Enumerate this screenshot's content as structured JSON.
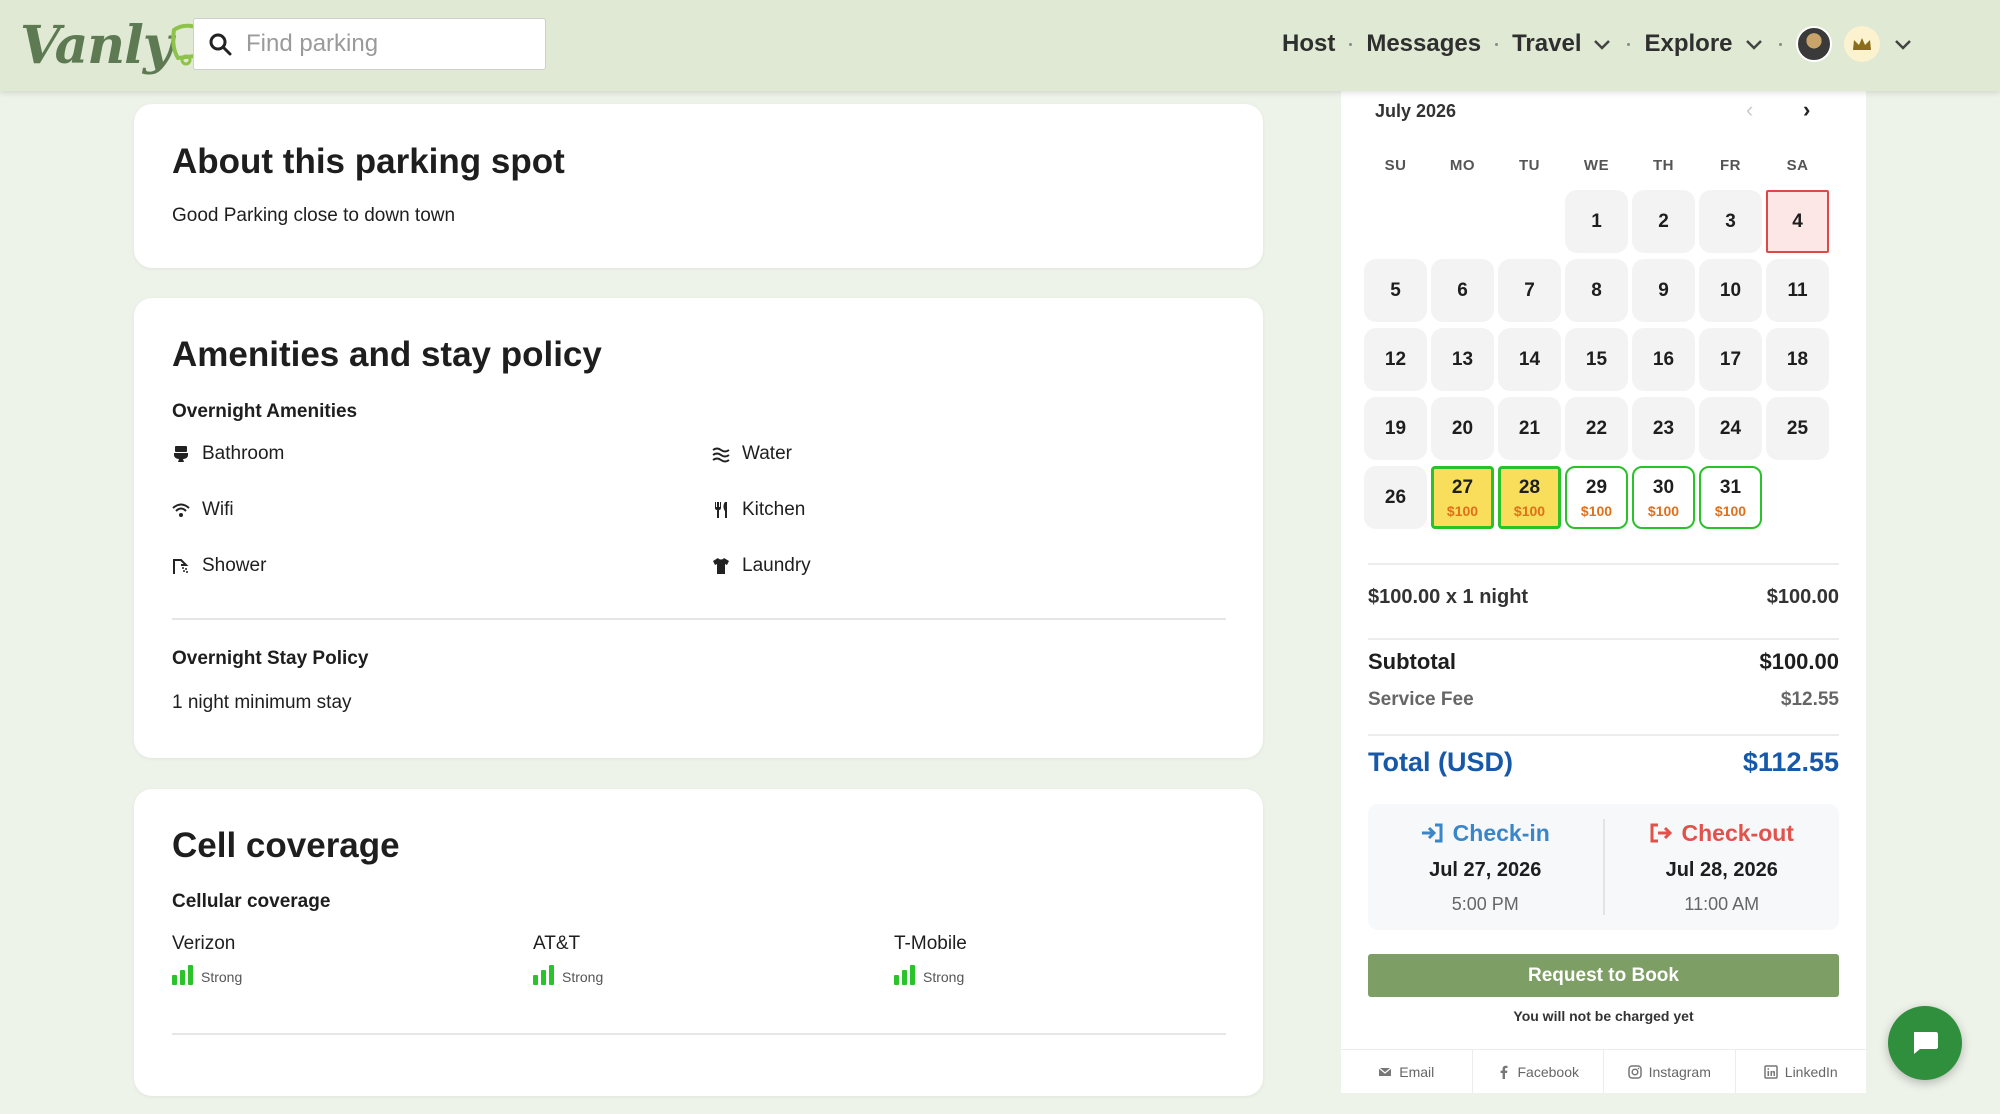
{
  "brand": {
    "logo_text": "Vanly"
  },
  "search": {
    "placeholder": "Find parking"
  },
  "nav": {
    "host": "Host",
    "messages": "Messages",
    "travel": "Travel",
    "explore": "Explore"
  },
  "about": {
    "title": "About this parking spot",
    "description": "Good Parking close to down town"
  },
  "amenities": {
    "title": "Amenities and stay policy",
    "overnight_label": "Overnight Amenities",
    "items": [
      {
        "label": "Bathroom",
        "icon": "toilet-icon"
      },
      {
        "label": "Water",
        "icon": "water-icon"
      },
      {
        "label": "Wifi",
        "icon": "wifi-icon"
      },
      {
        "label": "Kitchen",
        "icon": "utensils-icon"
      },
      {
        "label": "Shower",
        "icon": "shower-icon"
      },
      {
        "label": "Laundry",
        "icon": "shirt-icon"
      }
    ],
    "policy_label": "Overnight Stay Policy",
    "policy_text": "1 night minimum stay"
  },
  "cell": {
    "title": "Cell coverage",
    "subtitle": "Cellular coverage",
    "carriers": [
      {
        "name": "Verizon",
        "strength": "Strong"
      },
      {
        "name": "AT&T",
        "strength": "Strong"
      },
      {
        "name": "T-Mobile",
        "strength": "Strong"
      }
    ]
  },
  "calendar": {
    "month": "July 2026",
    "weekdays": [
      "SU",
      "MO",
      "TU",
      "WE",
      "TH",
      "FR",
      "SA"
    ],
    "today": "4",
    "selected": [
      "27",
      "28"
    ],
    "available": [
      "27",
      "28",
      "29",
      "30",
      "31"
    ],
    "price": "$100"
  },
  "pricing": {
    "nightly_label": "$100.00 x 1 night",
    "nightly_value": "$100.00",
    "subtotal_label": "Subtotal",
    "subtotal_value": "$100.00",
    "fee_label": "Service Fee",
    "fee_value": "$12.55",
    "total_label": "Total (USD)",
    "total_value": "$112.55"
  },
  "checkin": {
    "label": "Check-in",
    "date": "Jul 27, 2026",
    "time": "5:00 PM",
    "color": "#3a86c8"
  },
  "checkout": {
    "label": "Check-out",
    "date": "Jul 28, 2026",
    "time": "11:00 AM",
    "color": "#e0524b"
  },
  "booking": {
    "button": "Request to Book",
    "note": "You will not be charged yet"
  },
  "share": {
    "email": "Email",
    "facebook": "Facebook",
    "instagram": "Instagram",
    "linkedin": "LinkedIn"
  },
  "colors": {
    "accent": "#7d9e64",
    "available": "#2bc12b",
    "selected": "#f8de5a",
    "today": "#e04848",
    "total": "#1759a8"
  }
}
